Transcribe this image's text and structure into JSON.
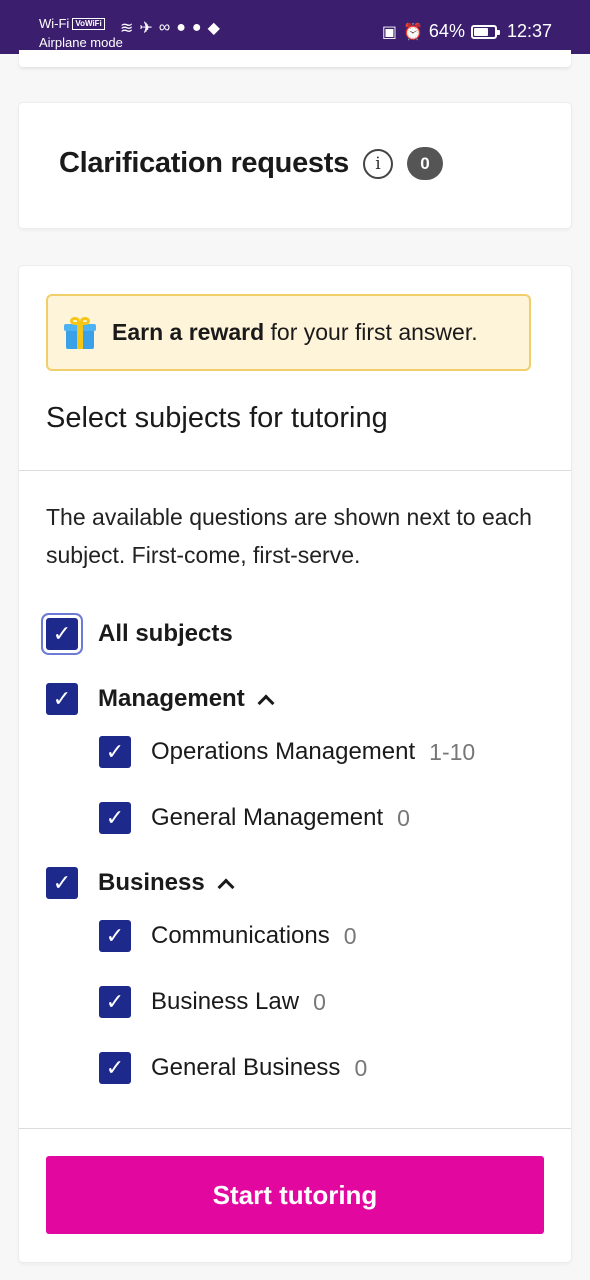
{
  "status_bar": {
    "wifi_label": "Wi-Fi",
    "volte": "VoWiFi",
    "mode": "Airplane mode",
    "battery": "64%",
    "time": "12:37"
  },
  "clarification": {
    "title": "Clarification requests",
    "count": "0"
  },
  "reward": {
    "bold": "Earn a reward",
    "rest": " for your first answer."
  },
  "subjects": {
    "title": "Select subjects for tutoring",
    "description": "The available questions are shown next to each subject. First-come, first-serve.",
    "all_label": "All subjects",
    "groups": [
      {
        "label": "Management",
        "items": [
          {
            "label": "Operations Management",
            "count": "1-10"
          },
          {
            "label": "General Management",
            "count": "0"
          }
        ]
      },
      {
        "label": "Business",
        "items": [
          {
            "label": "Communications",
            "count": "0"
          },
          {
            "label": "Business Law",
            "count": "0"
          },
          {
            "label": "General Business",
            "count": "0"
          }
        ]
      }
    ]
  },
  "start_button": "Start tutoring",
  "colors": {
    "status_bar": "#3b1f6e",
    "checkbox": "#1d2a8c",
    "cta": "#e2079e",
    "reward_bg": "#fdf4d9",
    "reward_border": "#f0cf6a"
  }
}
